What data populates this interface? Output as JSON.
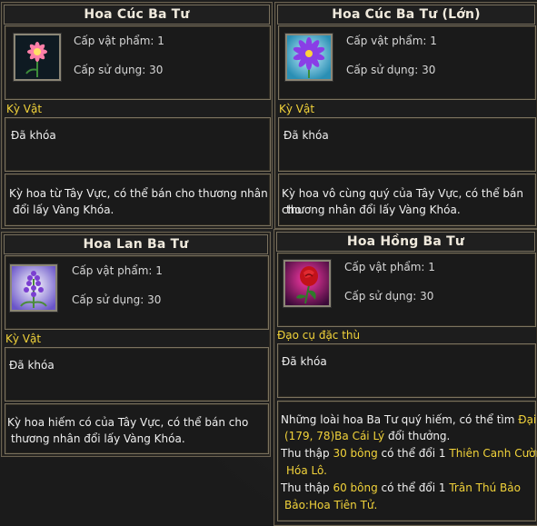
{
  "cards": [
    {
      "title": "Hoa Cúc Ba Tư",
      "level_label": "Cấp vật phẩm: 1",
      "use_label": "Cấp sử dụng: 30",
      "category": "Kỳ Vật",
      "lock": "Đã khóa",
      "desc_line1": "Kỳ hoa từ Tây Vực, có thể bán cho thương nhân",
      "desc_line2": "đổi lấy Vàng Khóa."
    },
    {
      "title": "Hoa Cúc Ba Tư (Lớn)",
      "level_label": "Cấp vật phẩm: 1",
      "use_label": "Cấp sử dụng: 30",
      "category": "Kỳ Vật",
      "lock": "Đã khóa",
      "desc_line1": "Kỳ hoa vô cùng quý của Tây Vực, có thể bán cho",
      "desc_line2": "thương nhân đổi lấy Vàng Khóa."
    },
    {
      "title": "Hoa Lan Ba Tư",
      "level_label": "Cấp vật phẩm: 1",
      "use_label": "Cấp sử dụng: 30",
      "category": "Kỳ Vật",
      "lock": "Đã khóa",
      "desc_line1": "Kỳ hoa hiếm có của Tây Vực, có thể bán cho",
      "desc_line2": "thương nhân đổi lấy Vàng Khóa."
    },
    {
      "title": "Hoa Hồng Ba Tư",
      "level_label": "Cấp vật phẩm: 1",
      "use_label": "Cấp sử dụng: 30",
      "category": "Đạo cụ đặc thù",
      "lock": "Đã khóa",
      "d1a": "Những loài hoa Ba Tư quý hiếm, có thể tìm ",
      "d1b": "Đại Lý",
      "d2a": "(179, 78)",
      "d2b": "Ba Cái Lý",
      "d2c": " đổi thưởng.",
      "d3a": "Thu thập ",
      "d3b": "30 bông",
      "d3c": " có thể đổi 1 ",
      "d3d": "Thiên Canh Cường",
      "d4": "Hóa Lô.",
      "d5a": "Thu thập ",
      "d5b": "60 bông",
      "d5c": " có thể đổi 1 ",
      "d5d": "Trân Thú Bảo",
      "d6": "Bảo:Hoa Tiên Tử."
    }
  ],
  "icons": {
    "card1": "pink-daisy-icon",
    "card2": "purple-daisy-icon",
    "card3": "lavender-flower-icon",
    "card4": "red-rose-icon"
  },
  "colors": {
    "highlight": "#f2d33a",
    "border": "#7c735f"
  }
}
